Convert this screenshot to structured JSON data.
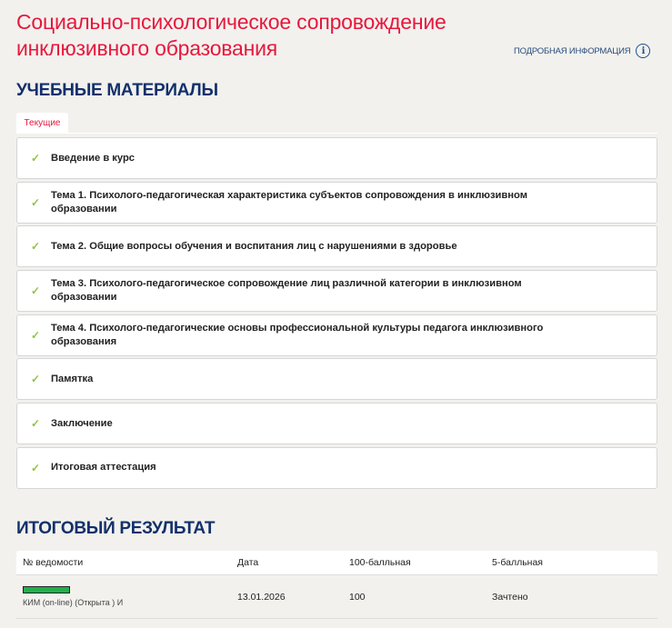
{
  "course": {
    "title": "Социально-психологическое сопровождение инклюзивного образования",
    "info_link": "ПОДРОБНАЯ ИНФОРМАЦИЯ"
  },
  "materials": {
    "heading": "УЧЕБНЫЕ МАТЕРИАЛЫ",
    "tab": "Текущие",
    "items": [
      "Введение в курс",
      "Тема 1. Психолого-педагогическая характеристика субъектов сопровождения в инклюзивном образовании",
      "Тема 2. Общие вопросы обучения и воспитания лиц с нарушениями в здоровье",
      "Тема 3. Психолого-педагогическое сопровождение лиц различной категории в инклюзивном образовании",
      "Тема 4. Психолого-педагогические основы профессиональной культуры педагога инклюзивного образования",
      "Памятка",
      "Заключение",
      "Итоговая аттестация"
    ]
  },
  "result": {
    "heading": "ИТОГОВЫЙ РЕЗУЛЬТАТ",
    "columns": [
      "№ ведомости",
      "Дата",
      "100-балльная",
      "5-балльная"
    ],
    "rows": [
      {
        "progress_percent": 100,
        "progress_color": "#22b04b",
        "sheet": "КИМ (on-line) (Открыта ) И",
        "date": "13.01.2026",
        "score100": "100",
        "score5": "Зачтено"
      }
    ]
  }
}
